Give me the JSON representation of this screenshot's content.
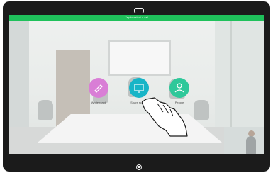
{
  "status_bar": {
    "text": "Tap to select a call"
  },
  "actions": [
    {
      "label": "Whiteboard",
      "icon": "whiteboard-icon",
      "color": "#d97ed6"
    },
    {
      "label": "Share screen",
      "icon": "share-screen-icon",
      "color": "#18b5c7"
    },
    {
      "label": "People",
      "icon": "person-icon",
      "color": "#2fc89a"
    }
  ],
  "colors": {
    "status_bar": "#1fc15b",
    "frame": "#1b1b1b"
  }
}
